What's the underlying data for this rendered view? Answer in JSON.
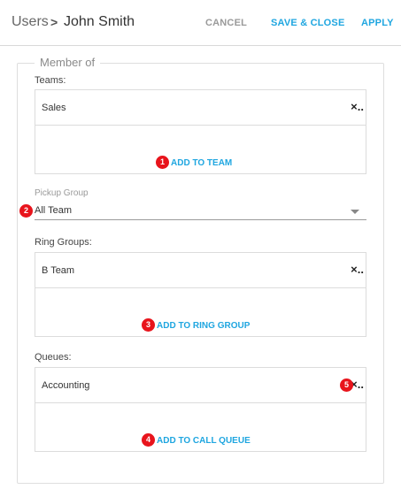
{
  "header": {
    "breadcrumb_root": "Users",
    "breadcrumb_separator": ">",
    "breadcrumb_current": "John Smith",
    "cancel_label": "CANCEL",
    "save_close_label": "SAVE & CLOSE",
    "apply_label": "APPLY"
  },
  "member_of": {
    "legend": "Member of",
    "teams": {
      "label": "Teams:",
      "items": [
        "Sales"
      ],
      "remove_icon": "×..",
      "add_label": "ADD TO TEAM",
      "badge": "1"
    },
    "pickup_group": {
      "label": "Pickup Group",
      "value": "All Team",
      "badge": "2"
    },
    "ring_groups": {
      "label": "Ring Groups:",
      "items": [
        "B Team"
      ],
      "remove_icon": "×..",
      "add_label": "ADD TO RING GROUP",
      "badge": "3"
    },
    "queues": {
      "label": "Queues:",
      "items": [
        "Accounting"
      ],
      "remove_icon": "×..",
      "add_label": "ADD TO CALL QUEUE",
      "badge_add": "4",
      "badge_remove": "5"
    }
  },
  "colors": {
    "accent": "#1fa6e0",
    "badge": "#e8141c",
    "muted": "#9a9a9a"
  }
}
